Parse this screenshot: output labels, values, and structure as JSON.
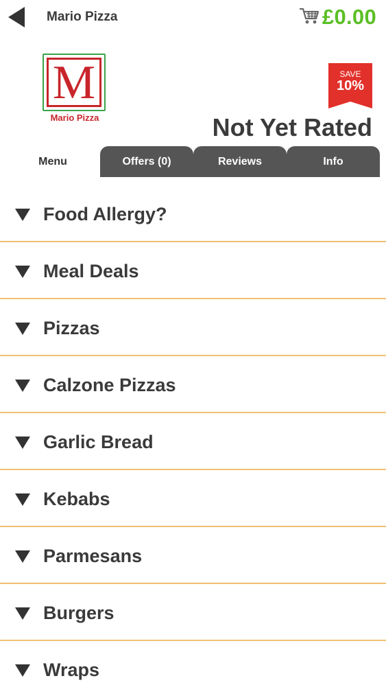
{
  "header": {
    "title": "Mario Pizza",
    "back_icon": "back-arrow-icon",
    "cart_icon": "shopping-cart-icon",
    "cart_total": "£0.00"
  },
  "restaurant": {
    "logo_letter": "M",
    "logo_name": "Mario Pizza",
    "badge_top": "SAVE",
    "badge_value": "10%",
    "rating_text": "Not Yet Rated"
  },
  "tabs": [
    {
      "label": "Menu",
      "active": true
    },
    {
      "label": "Offers (0)",
      "active": false
    },
    {
      "label": "Reviews",
      "active": false
    },
    {
      "label": "Info",
      "active": false
    }
  ],
  "categories": [
    {
      "label": "Food Allergy?"
    },
    {
      "label": "Meal Deals"
    },
    {
      "label": "Pizzas"
    },
    {
      "label": "Calzone Pizzas"
    },
    {
      "label": "Garlic Bread"
    },
    {
      "label": "Kebabs"
    },
    {
      "label": "Parmesans"
    },
    {
      "label": "Burgers"
    },
    {
      "label": "Wraps"
    }
  ],
  "colors": {
    "accent_green": "#5bbf25",
    "brand_red": "#c8252b",
    "tab_dark": "#555555",
    "divider": "#f0c070"
  }
}
